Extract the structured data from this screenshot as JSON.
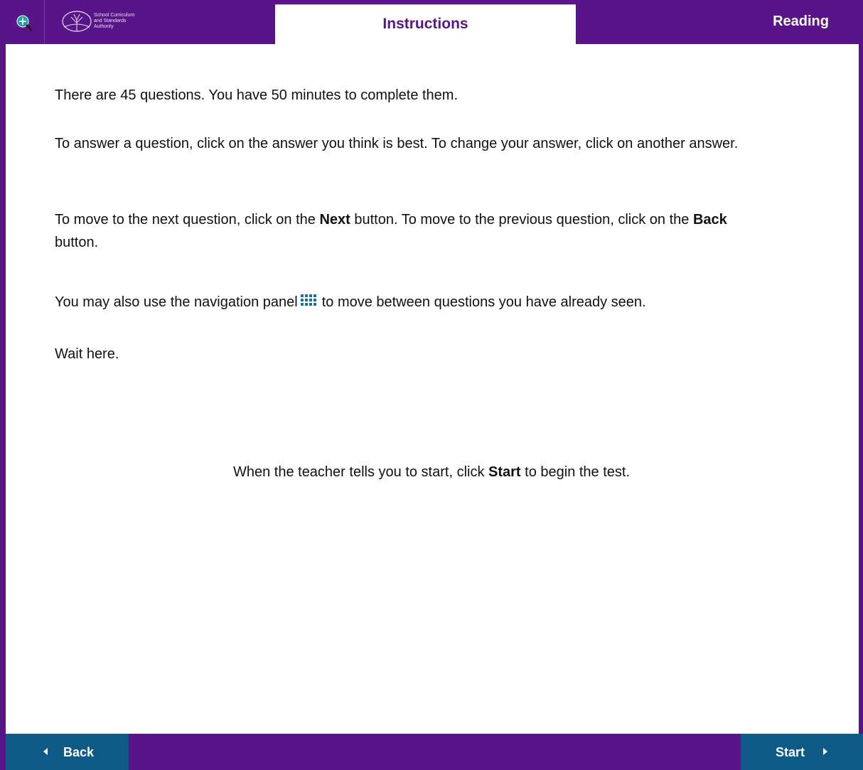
{
  "header": {
    "zoom_icon": "zoom-in-icon",
    "logo_lines": [
      "School Curriculum",
      "and Standards",
      "Authority"
    ],
    "title": "Instructions",
    "subject": "Reading"
  },
  "instructions": {
    "p1": "There are 45 questions. You have 50 minutes to complete them.",
    "p2": "To answer a question, click on the answer you think is best. To change your answer, click on another answer.",
    "p3_a": "To move to the next question, click on the ",
    "p3_next": "Next",
    "p3_b": " button. To move to the previous question, click on the ",
    "p3_back": "Back",
    "p3_c": " button.",
    "p4_a": "You may also use the navigation panel",
    "p4_icon": "grid-icon",
    "p4_b": "to move between questions you have already seen.",
    "p5": "Wait here.",
    "start_a": "When the teacher tells you to start, click ",
    "start_bold": "Start",
    "start_b": " to begin the test."
  },
  "footer": {
    "back_label": "Back",
    "start_label": "Start"
  },
  "colors": {
    "brand_purple": "#5a1489",
    "button_blue": "#0e5a86",
    "icon_blue": "#1b6ea8"
  }
}
